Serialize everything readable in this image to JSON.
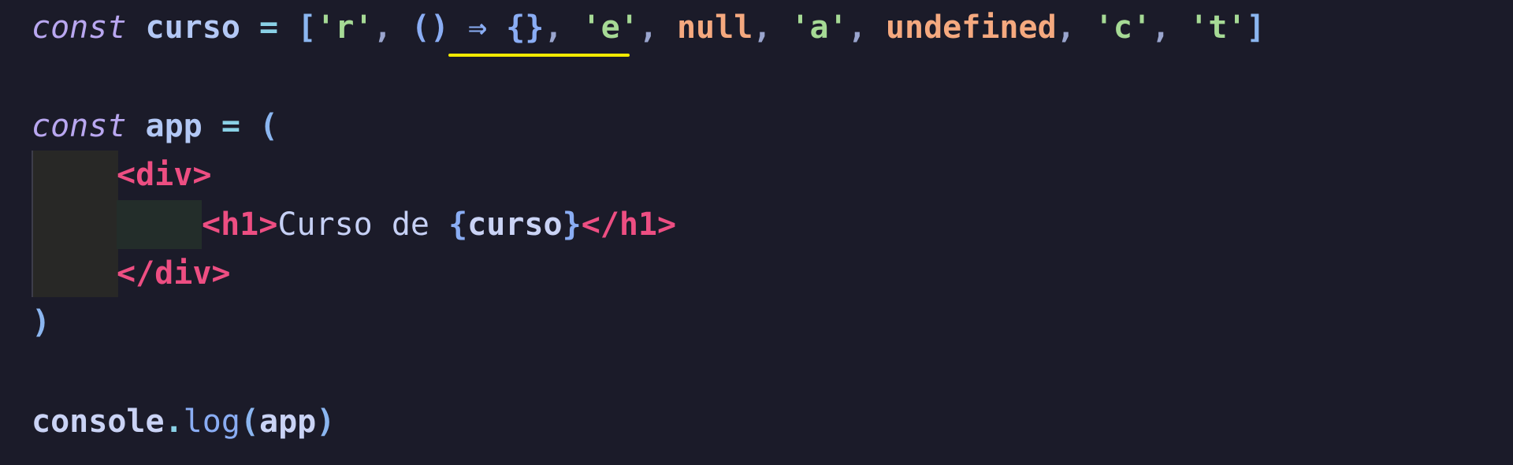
{
  "code": {
    "line1": {
      "kw": "const",
      "name": "curso",
      "eq": "=",
      "open": "[",
      "s_r": "'r'",
      "comma1": ",",
      "arrow_fn": "() ⇒ {}",
      "comma2": ",",
      "s_e": "'e'",
      "comma3": ",",
      "null": "null",
      "comma4": ",",
      "s_a": "'a'",
      "comma5": ",",
      "undefined": "undefined",
      "comma6": ",",
      "s_c": "'c'",
      "comma7": ",",
      "s_t": "'t'",
      "close": "]"
    },
    "line3": {
      "kw": "const",
      "name": "app",
      "eq": "=",
      "paren": "("
    },
    "line4": {
      "tag": "<div>"
    },
    "line5": {
      "open_tag": "<h1>",
      "text": "Curso de ",
      "brace_open": "{",
      "expr": "curso",
      "brace_close": "}",
      "close_tag": "</h1>"
    },
    "line6": {
      "tag": "</div>"
    },
    "line7": {
      "paren": ")"
    },
    "line9": {
      "obj": "console",
      "dot": ".",
      "method": "log",
      "paren_open": "(",
      "arg": "app",
      "paren_close": ")"
    }
  },
  "colors": {
    "background": "#1b1b29",
    "squiggle": "#f2e900"
  }
}
